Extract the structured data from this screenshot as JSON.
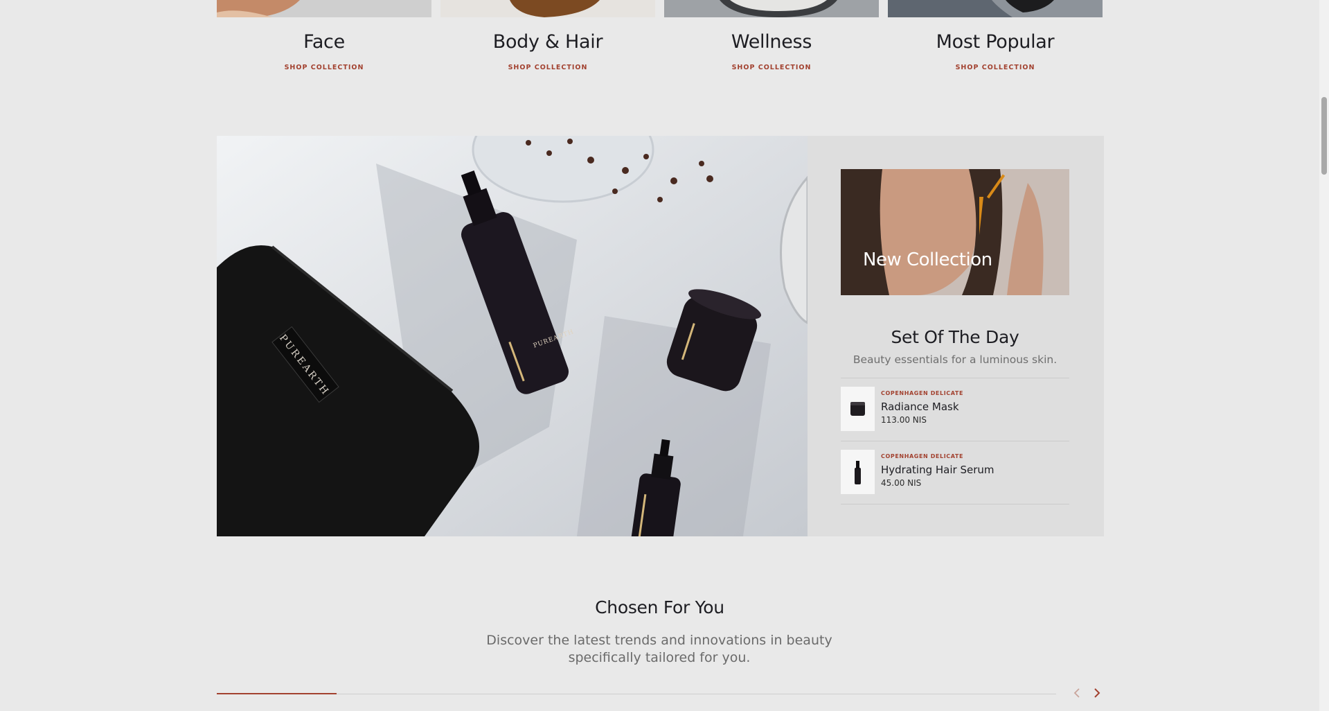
{
  "categories": [
    {
      "title": "Face",
      "link": "SHOP COLLECTION",
      "thumb_color": "#b07a5c"
    },
    {
      "title": "Body & Hair",
      "link": "SHOP COLLECTION",
      "thumb_color": "#7a4a26"
    },
    {
      "title": "Wellness",
      "link": "SHOP COLLECTION",
      "thumb_color": "#8d8f92"
    },
    {
      "title": "Most Popular",
      "link": "SHOP COLLECTION",
      "thumb_color": "#2f3440"
    }
  ],
  "hero": {
    "photo_alt": "Purearth product flatlay",
    "bottle_label_1": "PUREARTH",
    "bag_label": "PUREARTH"
  },
  "promo": {
    "label": "New Collection"
  },
  "set_of_the_day": {
    "title": "Set Of The Day",
    "subtitle": "Beauty essentials for a luminous skin.",
    "products": [
      {
        "brand": "COPENHAGEN DELICATE",
        "name": "Radiance Mask",
        "price": "113.00 NIS",
        "icon": "jar-icon"
      },
      {
        "brand": "COPENHAGEN DELICATE",
        "name": "Hydrating Hair Serum",
        "price": "45.00 NIS",
        "icon": "bottle-icon"
      }
    ]
  },
  "chosen": {
    "title": "Chosen For You",
    "subtitle": "Discover the latest trends and innovations in beauty specifically tailored for you.",
    "progress_fraction": 0.143,
    "prev_icon": "chevron-left-icon",
    "next_icon": "chevron-right-icon"
  },
  "colors": {
    "accent": "#a2412f",
    "background": "#e9e9e9",
    "text": "#1d1d22"
  }
}
